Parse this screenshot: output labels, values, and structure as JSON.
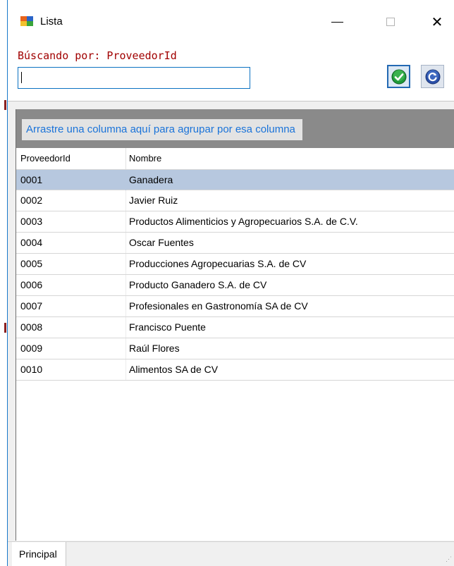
{
  "window": {
    "title": "Lista",
    "close_glyph": "✕"
  },
  "search": {
    "label": "Búscando por: ProveedorId",
    "value": "",
    "placeholder": ""
  },
  "grid": {
    "group_hint": "Arrastre una columna aquí para agrupar por esa columna",
    "columns": [
      "ProveedorId",
      "Nombre"
    ],
    "rows": [
      {
        "id": "0001",
        "name": "Ganadera"
      },
      {
        "id": "0002",
        "name": "Javier Ruiz"
      },
      {
        "id": "0003",
        "name": "Productos Alimenticios y Agropecuarios S.A. de C.V."
      },
      {
        "id": "0004",
        "name": "Oscar Fuentes"
      },
      {
        "id": "0005",
        "name": "Producciones Agropecuarias S.A. de CV"
      },
      {
        "id": "0006",
        "name": "Producto Ganadero S.A. de CV"
      },
      {
        "id": "0007",
        "name": "Profesionales en Gastronomía SA de CV"
      },
      {
        "id": "0008",
        "name": "Francisco Puente"
      },
      {
        "id": "0009",
        "name": "Raúl Flores"
      },
      {
        "id": "0010",
        "name": "Alimentos SA de CV"
      }
    ]
  },
  "tabs": {
    "principal": "Principal"
  },
  "colors": {
    "accent": "#0b72c2",
    "label_red": "#a10000",
    "selected_row": "#b7c8df",
    "hint_blue": "#1a73d9"
  }
}
